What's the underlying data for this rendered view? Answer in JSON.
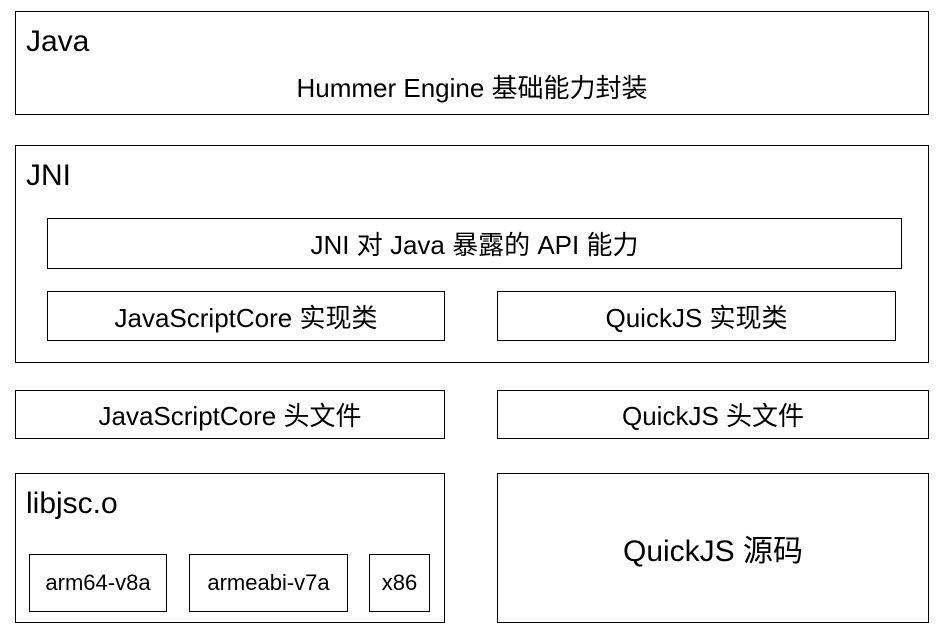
{
  "java_layer": {
    "label": "Java",
    "caption": "Hummer Engine 基础能力封装"
  },
  "jni_layer": {
    "label": "JNI",
    "api_box": "JNI 对 Java 暴露的 API 能力",
    "jsc_impl": "JavaScriptCore 实现类",
    "quickjs_impl": "QuickJS 实现类"
  },
  "headers": {
    "jsc_header": "JavaScriptCore 头文件",
    "quickjs_header": "QuickJS 头文件"
  },
  "libjsc": {
    "label": "libjsc.o",
    "abis": [
      "arm64-v8a",
      "armeabi-v7a",
      "x86"
    ]
  },
  "quickjs_source": {
    "label": "QuickJS 源码"
  },
  "colors": {
    "stroke": "#000000",
    "fill": "#ffffff",
    "text": "#000000"
  }
}
